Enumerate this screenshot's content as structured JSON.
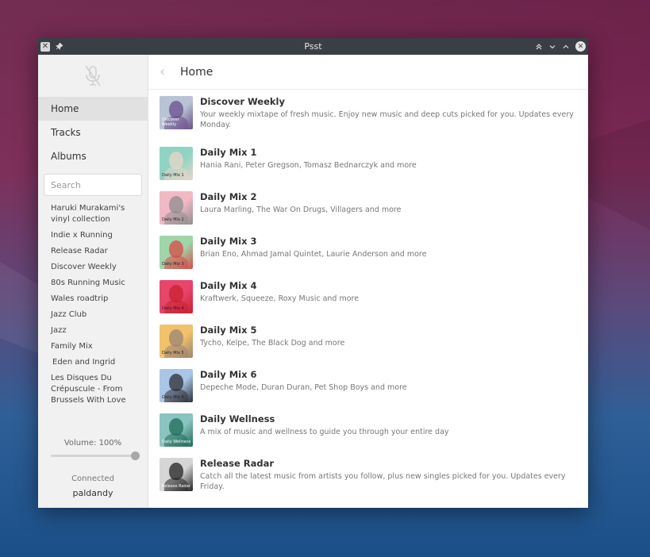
{
  "window": {
    "title": "Psst"
  },
  "sidebar": {
    "nav": [
      {
        "label": "Home"
      },
      {
        "label": "Tracks"
      },
      {
        "label": "Albums"
      }
    ],
    "search_placeholder": "Search",
    "playlists": [
      "Haruki Murakami's vinyl collection",
      "Indie x Running",
      "Release Radar",
      "Discover Weekly",
      "80s Running Music",
      "Wales roadtrip",
      "Jazz Club",
      "Jazz",
      "Family Mix",
      "Eden and Ingrid",
      "Les Disques Du Crépuscule - From Brussels With Love"
    ],
    "volume_label": "Volume: 100%",
    "volume_level": 1.0,
    "status": "Connected",
    "username": "paldandy"
  },
  "main": {
    "title": "Home",
    "items": [
      {
        "name": "Discover Weekly",
        "desc": "Your weekly mixtape of fresh music. Enjoy new music and deep cuts picked for you. Updates every Monday.",
        "art_label": "Discover Weekly",
        "bg": "#b9c3d6",
        "fg": "#6a4e8a"
      },
      {
        "name": "Daily Mix 1",
        "desc": "Hania Rani, Peter Gregson, Tomasz Bednarczyk and more",
        "art_label": "Daily Mix 1",
        "bg": "#8fd3c3",
        "fg": "#e8d6c8"
      },
      {
        "name": "Daily Mix 2",
        "desc": "Laura Marling, The War On Drugs, Villagers and more",
        "art_label": "Daily Mix 2",
        "bg": "#f1b9c5",
        "fg": "#8e8e8e"
      },
      {
        "name": "Daily Mix 3",
        "desc": "Brian Eno, Ahmad Jamal Quintet, Laurie Anderson and more",
        "art_label": "Daily Mix 3",
        "bg": "#9fd6a9",
        "fg": "#d94848"
      },
      {
        "name": "Daily Mix 4",
        "desc": "Kraftwerk, Squeeze, Roxy Music and more",
        "art_label": "Daily Mix 4",
        "bg": "#e8456b",
        "fg": "#c92130"
      },
      {
        "name": "Daily Mix 5",
        "desc": "Tycho, Kelpe, The Black Dog and more",
        "art_label": "Daily Mix 5",
        "bg": "#f2c26b",
        "fg": "#9a8474"
      },
      {
        "name": "Daily Mix 6",
        "desc": "Depeche Mode, Duran Duran, Pet Shop Boys and more",
        "art_label": "Daily Mix 6",
        "bg": "#a9c6e6",
        "fg": "#2d2d35"
      },
      {
        "name": "Daily Wellness",
        "desc": "A mix of music and wellness to guide you through your entire day",
        "art_label": "Daily Wellness",
        "bg": "#8ac4c0",
        "fg": "#1f6b58"
      },
      {
        "name": "Release Radar",
        "desc": "Catch all the latest music from artists you follow, plus new singles picked for you. Updates every Friday.",
        "art_label": "Release Radar",
        "bg": "#d6d6d6",
        "fg": "#222222"
      }
    ]
  },
  "colors": {
    "titlebar": "#3a3f45",
    "sidebar_bg": "#f1f1f1",
    "active_nav": "#e1e1e1"
  }
}
